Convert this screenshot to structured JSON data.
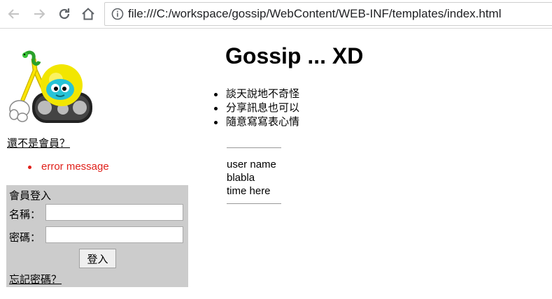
{
  "browser": {
    "url": "file:///C:/workspace/gossip/WebContent/WEB-INF/templates/index.html"
  },
  "sidebar": {
    "join_link": "還不是會員？",
    "errors": [
      "error message"
    ],
    "login": {
      "title": "會員登入",
      "name_label": "名稱：",
      "name_value": "",
      "password_label": "密碼：",
      "password_value": "",
      "submit_label": "登入",
      "forgot_link": "忘記密碼？"
    }
  },
  "main": {
    "heading": "Gossip ... XD",
    "features": [
      "談天說地不奇怪",
      "分享訊息也可以",
      "隨意寫寫表心情"
    ],
    "message": {
      "username": "user name",
      "text": "blabla",
      "time": "time here"
    }
  },
  "colors": {
    "error": "#e0201a",
    "login_box_bg": "#cccccc"
  }
}
